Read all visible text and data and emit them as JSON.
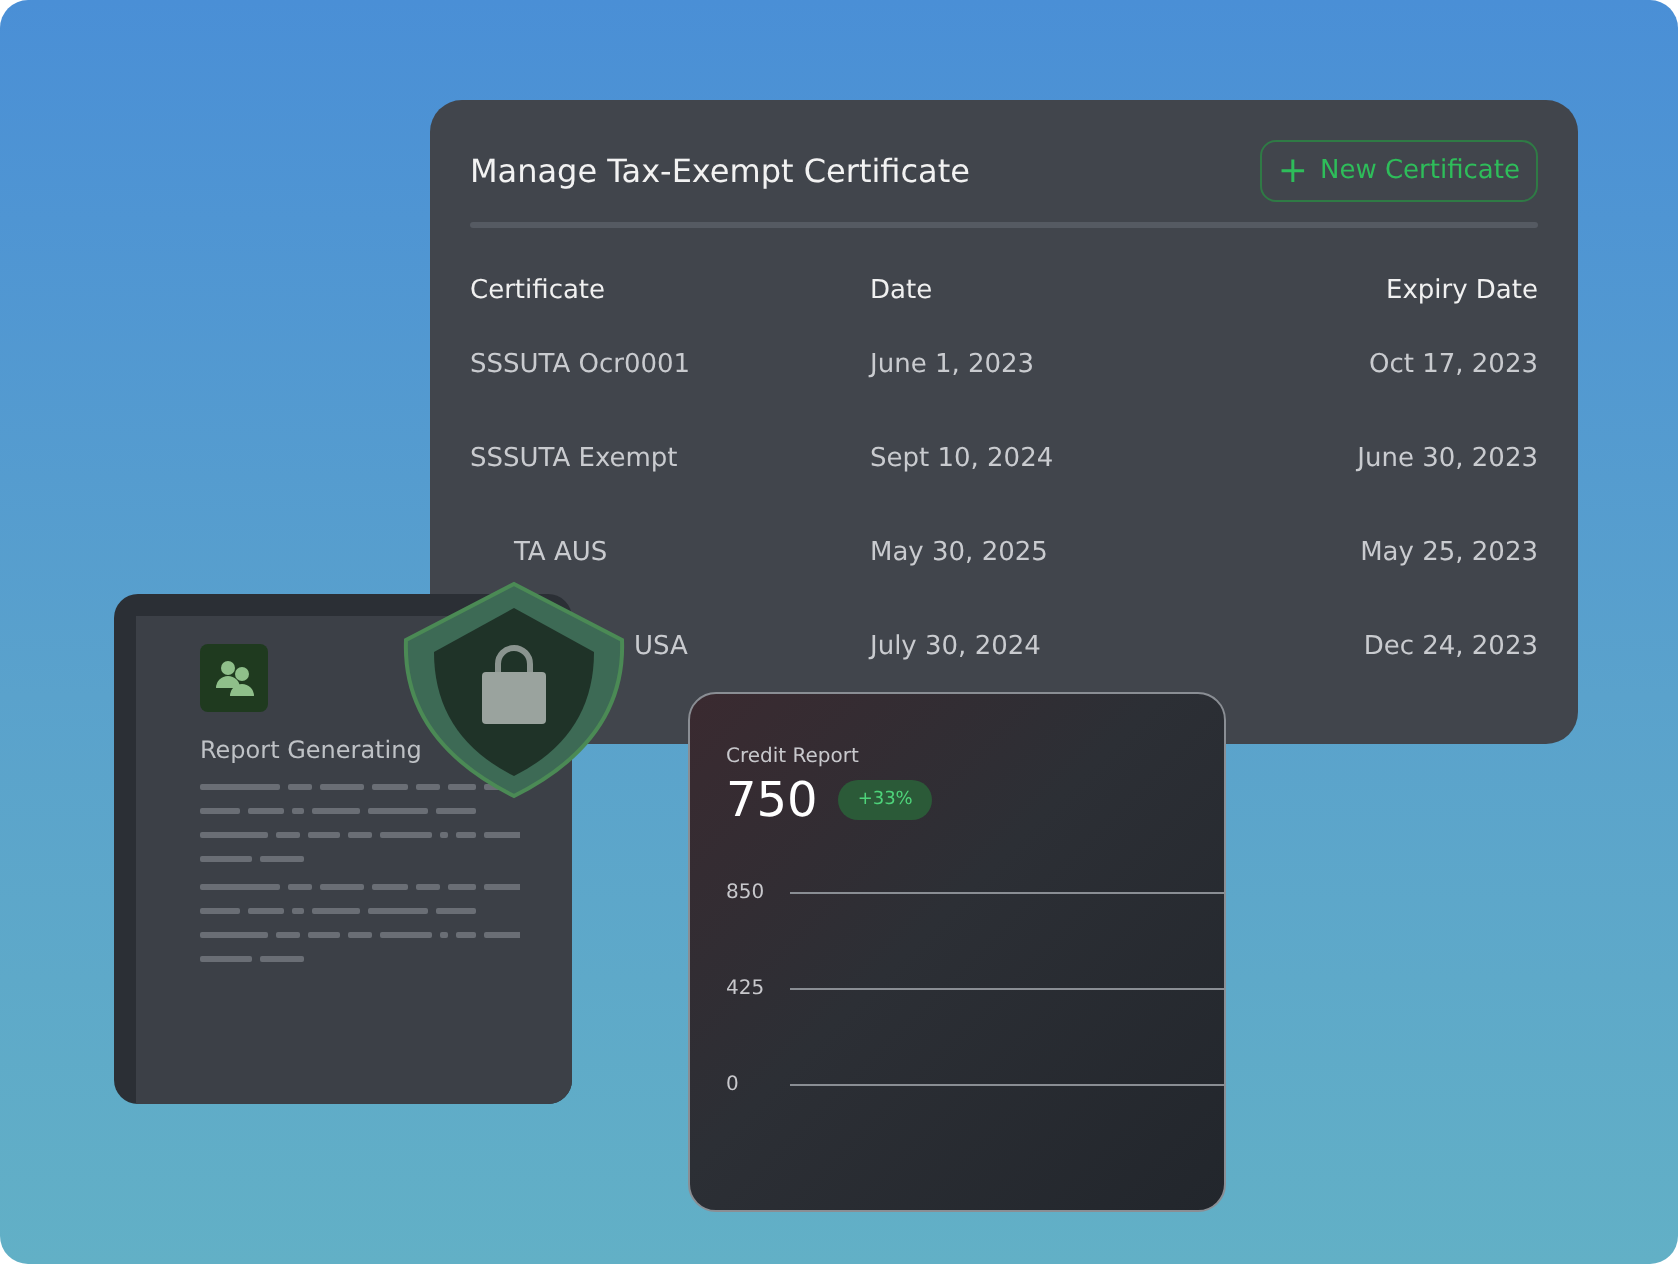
{
  "certificates": {
    "title": "Manage Tax-Exempt Certificate",
    "new_button": {
      "label": "New Certificate",
      "icon": "+"
    },
    "columns": [
      "Certificate",
      "Date",
      "Expiry Date"
    ],
    "rows": [
      {
        "certificate": "SSSUTA Ocr0001",
        "date": "June 1, 2023",
        "expiry": "Oct 17, 2023"
      },
      {
        "certificate": "SSSUTA Exempt",
        "date": "Sept 10, 2024",
        "expiry": "June 30, 2023"
      },
      {
        "certificate": "TA AUS",
        "date": "May 30, 2025",
        "expiry": "May 25, 2023"
      },
      {
        "certificate": "USA",
        "date": "July 30, 2024",
        "expiry": "Dec 24, 2023"
      }
    ]
  },
  "report": {
    "title": "Report Generating"
  },
  "credit": {
    "title": "Credit Report",
    "score": "750",
    "change": "+33%",
    "y_labels": [
      "850",
      "425",
      "0"
    ]
  }
}
